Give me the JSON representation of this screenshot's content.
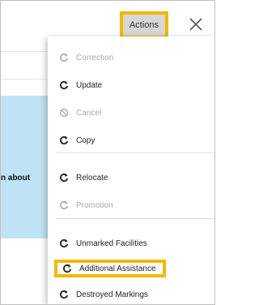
{
  "header": {
    "actions_label": "Actions",
    "close_icon": "close-icon"
  },
  "background": {
    "partial_text": "n about"
  },
  "menu": {
    "items": [
      {
        "label": "Correction",
        "icon": "redo-icon",
        "enabled": false
      },
      {
        "label": "Update",
        "icon": "redo-icon",
        "enabled": true
      },
      {
        "label": "Cancel",
        "icon": "cancel-icon",
        "enabled": false
      },
      {
        "label": "Copy",
        "icon": "redo-icon",
        "enabled": true
      },
      {
        "label": "Relocate",
        "icon": "redo-icon",
        "enabled": true
      },
      {
        "label": "Promotion",
        "icon": "redo-icon",
        "enabled": false
      },
      {
        "label": "Unmarked Facilities",
        "icon": "redo-icon",
        "enabled": true
      },
      {
        "label": "Additional Assistance",
        "icon": "redo-icon",
        "enabled": true,
        "highlighted": true
      },
      {
        "label": "Destroyed Markings",
        "icon": "redo-icon",
        "enabled": true
      }
    ]
  },
  "colors": {
    "highlight": "#f2b705",
    "panel": "#bfe3f4",
    "button_bg": "#d6d6d6"
  }
}
